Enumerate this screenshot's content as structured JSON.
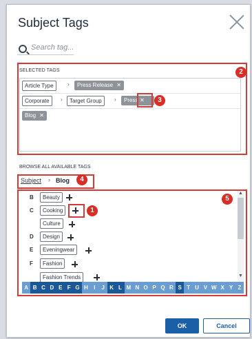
{
  "dialog": {
    "title": "Subject Tags",
    "search": {
      "placeholder": "Search tag..."
    },
    "selected": {
      "label": "SELECTED TAGS",
      "rows": [
        {
          "chips": [
            "Article Type"
          ],
          "current": "Press Release"
        },
        {
          "chips": [
            "Corporate",
            "Target Group"
          ],
          "current": "Press"
        },
        {
          "chips": [],
          "current": "Blog"
        }
      ]
    },
    "browse": {
      "label": "BROWSE ALL AVAILABLE TAGS",
      "breadcrumb": {
        "root": "Subject",
        "separator": "›",
        "current": "Blog"
      },
      "tags": [
        {
          "letter": "B",
          "name": "Beauty"
        },
        {
          "letter": "C",
          "name": "Cooking"
        },
        {
          "letter": "",
          "name": "Culture"
        },
        {
          "letter": "D",
          "name": "Design"
        },
        {
          "letter": "E",
          "name": "Eveningwear"
        },
        {
          "letter": "F",
          "name": "Fashion"
        },
        {
          "letter": "",
          "name": "Fashion Trends"
        }
      ],
      "alphabet": [
        "A",
        "B",
        "C",
        "D",
        "E",
        "F",
        "G",
        "H",
        "I",
        "J",
        "K",
        "L",
        "M",
        "N",
        "O",
        "P",
        "Q",
        "R",
        "S",
        "T",
        "U",
        "V",
        "W",
        "X",
        "Y",
        "Z"
      ],
      "active_letters": [
        "B",
        "C",
        "D",
        "E",
        "F",
        "G",
        "K",
        "L",
        "S"
      ]
    },
    "annotations": [
      "1",
      "2",
      "3",
      "4",
      "5"
    ],
    "buttons": {
      "ok": "OK",
      "cancel": "Cancel"
    },
    "colors": {
      "primary": "#1b5fa6",
      "annotation": "#d33b36",
      "alphabet_bar": "#6a9ed3",
      "alphabet_active": "#1b5898"
    }
  }
}
